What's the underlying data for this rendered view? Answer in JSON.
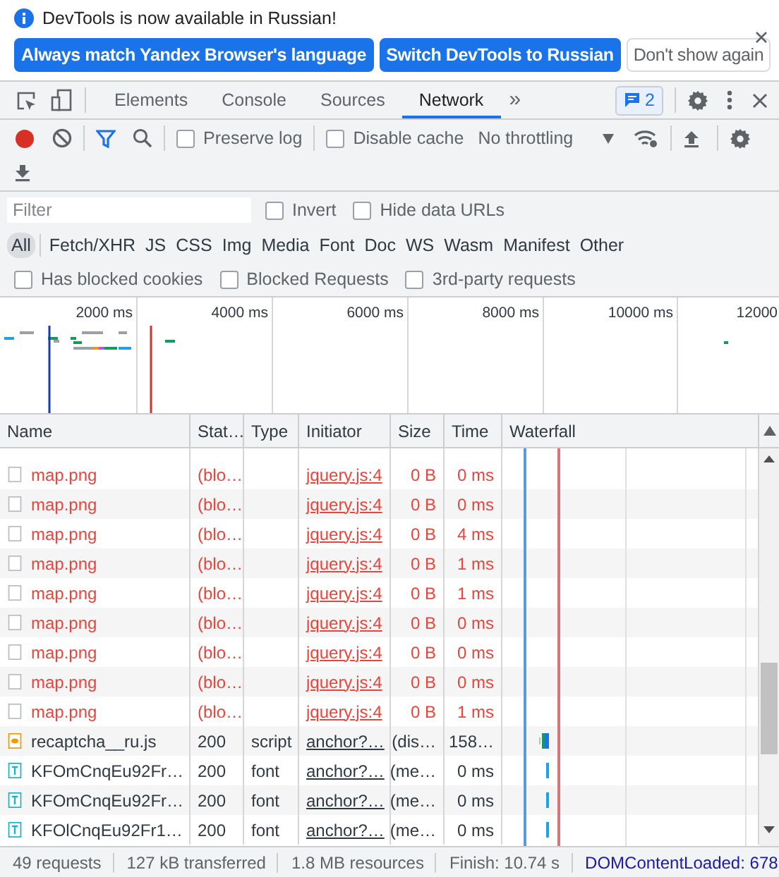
{
  "infobar": {
    "message": "DevTools is now available in Russian!",
    "buttons": [
      {
        "label": "Always match Yandex Browser's language",
        "kind": "primary"
      },
      {
        "label": "Switch DevTools to Russian",
        "kind": "primary"
      },
      {
        "label": "Don't show again",
        "kind": "plain"
      }
    ]
  },
  "tabs": [
    {
      "label": "Elements",
      "selected": false
    },
    {
      "label": "Console",
      "selected": false
    },
    {
      "label": "Sources",
      "selected": false
    },
    {
      "label": "Network",
      "selected": true
    }
  ],
  "more_tabs": "»",
  "issues_badge": "2",
  "toolbar": {
    "recording": true,
    "filter_active": true,
    "options": [
      {
        "label": "Preserve log",
        "checked": false
      },
      {
        "label": "Disable cache",
        "checked": false
      }
    ],
    "throttling": "No throttling"
  },
  "filter": {
    "placeholder": "Filter",
    "options": [
      {
        "label": "Invert",
        "checked": false
      },
      {
        "label": "Hide data URLs",
        "checked": false
      }
    ]
  },
  "type_filters": [
    {
      "label": "All",
      "selected": true
    },
    {
      "label": "Fetch/XHR",
      "selected": false
    },
    {
      "label": "JS",
      "selected": false
    },
    {
      "label": "CSS",
      "selected": false
    },
    {
      "label": "Img",
      "selected": false
    },
    {
      "label": "Media",
      "selected": false
    },
    {
      "label": "Font",
      "selected": false
    },
    {
      "label": "Doc",
      "selected": false
    },
    {
      "label": "WS",
      "selected": false
    },
    {
      "label": "Wasm",
      "selected": false
    },
    {
      "label": "Manifest",
      "selected": false
    },
    {
      "label": "Other",
      "selected": false
    }
  ],
  "blocked_filters": [
    {
      "label": "Has blocked cookies",
      "checked": false
    },
    {
      "label": "Blocked Requests",
      "checked": false
    },
    {
      "label": "3rd-party requests",
      "checked": false
    }
  ],
  "overview": {
    "ticks": [
      "2000 ms",
      "4000 ms",
      "6000 ms",
      "8000 ms",
      "10000 ms",
      "12000"
    ]
  },
  "table": {
    "columns": [
      "Name",
      "Stat…",
      "Type",
      "Initiator",
      "Size",
      "Time",
      "Waterfall"
    ],
    "rows": [
      {
        "kind": "blocked",
        "name": "map.png",
        "status": "(blo…",
        "type": "",
        "initiator": "jquery.js:4",
        "size": "0 B",
        "time": "0 ms"
      },
      {
        "kind": "blocked",
        "name": "map.png",
        "status": "(blo…",
        "type": "",
        "initiator": "jquery.js:4",
        "size": "0 B",
        "time": "0 ms"
      },
      {
        "kind": "blocked",
        "name": "map.png",
        "status": "(blo…",
        "type": "",
        "initiator": "jquery.js:4",
        "size": "0 B",
        "time": "4 ms"
      },
      {
        "kind": "blocked",
        "name": "map.png",
        "status": "(blo…",
        "type": "",
        "initiator": "jquery.js:4",
        "size": "0 B",
        "time": "1 ms"
      },
      {
        "kind": "blocked",
        "name": "map.png",
        "status": "(blo…",
        "type": "",
        "initiator": "jquery.js:4",
        "size": "0 B",
        "time": "1 ms"
      },
      {
        "kind": "blocked",
        "name": "map.png",
        "status": "(blo…",
        "type": "",
        "initiator": "jquery.js:4",
        "size": "0 B",
        "time": "0 ms"
      },
      {
        "kind": "blocked",
        "name": "map.png",
        "status": "(blo…",
        "type": "",
        "initiator": "jquery.js:4",
        "size": "0 B",
        "time": "0 ms"
      },
      {
        "kind": "blocked",
        "name": "map.png",
        "status": "(blo…",
        "type": "",
        "initiator": "jquery.js:4",
        "size": "0 B",
        "time": "0 ms"
      },
      {
        "kind": "blocked",
        "name": "map.png",
        "status": "(blo…",
        "type": "",
        "initiator": "jquery.js:4",
        "size": "0 B",
        "time": "1 ms"
      },
      {
        "kind": "script",
        "name": "recaptcha__ru.js",
        "status": "200",
        "type": "script",
        "initiator": "anchor?…",
        "size": "(dis…",
        "time": "158…"
      },
      {
        "kind": "font",
        "name": "KFOmCnqEu92Fr…",
        "status": "200",
        "type": "font",
        "initiator": "anchor?…",
        "size": "(me…",
        "time": "0 ms"
      },
      {
        "kind": "font",
        "name": "KFOmCnqEu92Fr…",
        "status": "200",
        "type": "font",
        "initiator": "anchor?…",
        "size": "(me…",
        "time": "0 ms"
      },
      {
        "kind": "font",
        "name": "KFOlCnqEu92Fr1…",
        "status": "200",
        "type": "font",
        "initiator": "anchor?…",
        "size": "(me…",
        "time": "0 ms"
      }
    ]
  },
  "status_bar": [
    "49 requests",
    "127 kB transferred",
    "1.8 MB resources",
    "Finish: 10.74 s",
    "DOMContentLoaded: 678"
  ]
}
